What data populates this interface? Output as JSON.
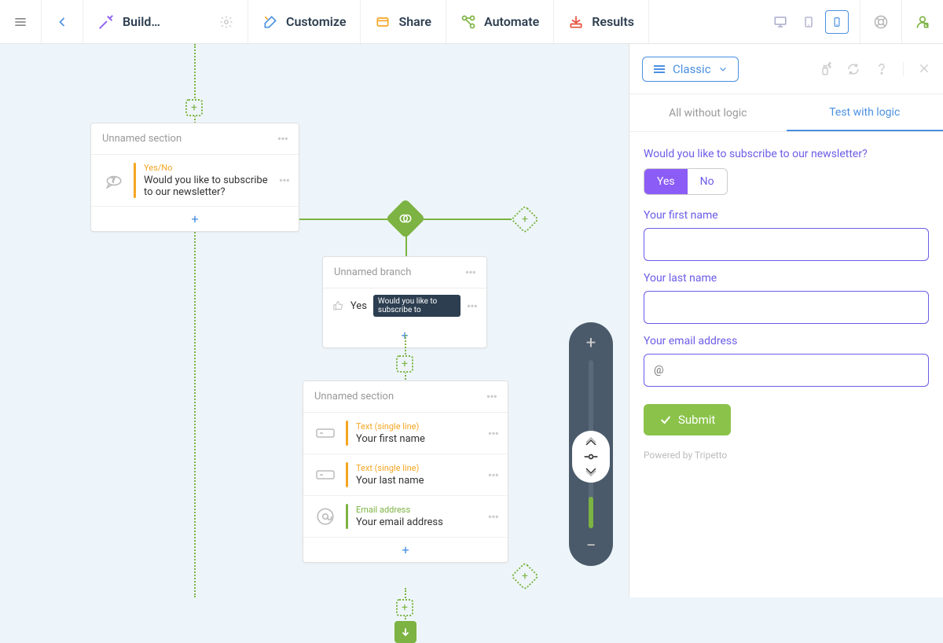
{
  "toolbar": {
    "build": "Build…",
    "customize": "Customize",
    "share": "Share",
    "automate": "Automate",
    "results": "Results"
  },
  "canvas": {
    "section1": {
      "title": "Unnamed section",
      "q1_type": "Yes/No",
      "q1_text": "Would you like to subscribe to our newsletter?"
    },
    "branch": {
      "title": "Unnamed branch",
      "cond_value": "Yes",
      "cond_chip": "Would you like to subscribe to"
    },
    "section2": {
      "title": "Unnamed section",
      "f1_type": "Text (single line)",
      "f1_label": "Your first name",
      "f2_type": "Text (single line)",
      "f2_label": "Your last name",
      "f3_type": "Email address",
      "f3_label": "Your email address"
    }
  },
  "preview": {
    "mode": "Classic",
    "tab_all": "All without logic",
    "tab_test": "Test with logic",
    "q1": "Would you like to subscribe to our newsletter?",
    "yes": "Yes",
    "no": "No",
    "firstname_label": "Your first name",
    "lastname_label": "Your last name",
    "email_label": "Your email address",
    "email_placeholder": "@",
    "submit": "Submit",
    "powered": "Powered by Tripetto"
  }
}
